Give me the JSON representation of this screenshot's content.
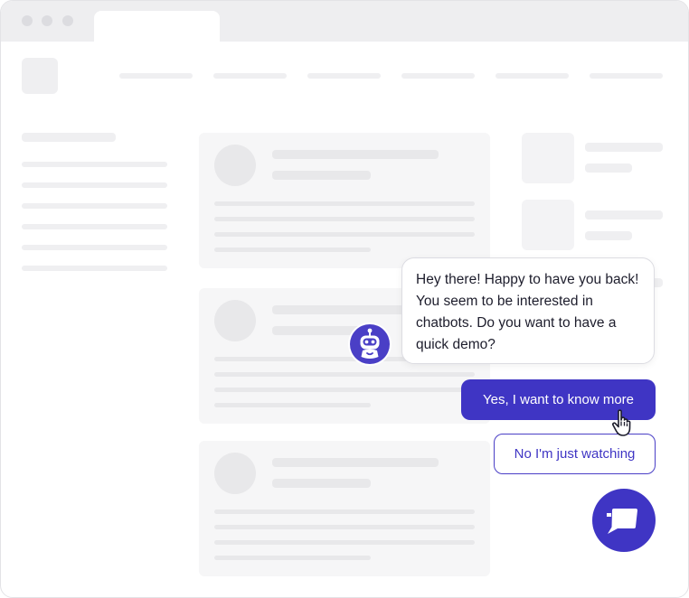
{
  "chat": {
    "message": "Hey there! Happy to have you back! You seem to be interested in chatbots. Do you want to have a quick demo?",
    "option_yes": "Yes, I want to know more",
    "option_no": "No I'm just watching"
  },
  "icons": {
    "bot_avatar": "robot-icon",
    "launcher": "chat-bubble-icon",
    "cursor": "hand-pointer-icon"
  },
  "colors": {
    "accent": "#3f35c4",
    "placeholder": "#efeff1",
    "card": "#f6f6f7"
  }
}
